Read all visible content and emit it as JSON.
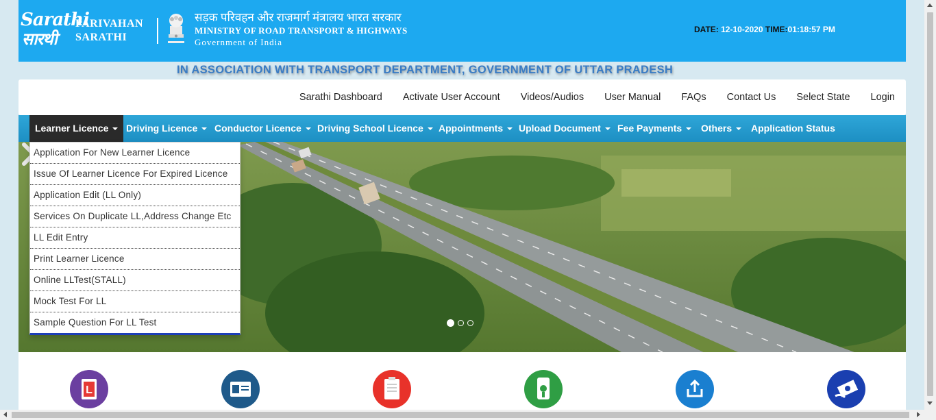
{
  "header": {
    "logo_line1": "Sarathi",
    "logo_line2": "सारथी",
    "brand_line1": "PARIVAHAN",
    "brand_line2": "SARATHI",
    "ministry_hindi": "सड़क परिवहन और राजमार्ग मंत्रालय भारत सरकार",
    "ministry_english": "MINISTRY OF ROAD TRANSPORT & HIGHWAYS",
    "government": "Government of India",
    "date_label": "DATE:",
    "date_value": "12-10-2020",
    "time_label": "TIME:",
    "time_value": "01:18:57 PM"
  },
  "association": "IN ASSOCIATION WITH TRANSPORT DEPARTMENT, GOVERNMENT OF UTTAR PRADESH",
  "topnav": [
    "Sarathi Dashboard",
    "Activate User Account",
    "Videos/Audios",
    "User Manual",
    "FAQs",
    "Contact Us",
    "Select State",
    "Login"
  ],
  "mainmenu": [
    "Learner Licence",
    "Driving Licence",
    "Conductor Licence",
    "Driving School Licence",
    "Appointments",
    "Upload Document",
    "Fee Payments",
    "Others",
    "Application Status"
  ],
  "dropdown": [
    "Application For New Learner Licence",
    "Issue Of Learner Licence For Expired Licence",
    "Application Edit (LL Only)",
    "Services On Duplicate LL,Address Change Etc",
    "LL Edit Entry",
    "Print Learner Licence",
    "Online LLTest(STALL)",
    "Mock Test For LL",
    "Sample Question For LL Test"
  ],
  "carousel": {
    "slides": 3,
    "active": 1
  },
  "service_icons": [
    {
      "icon": "learner-licence-icon",
      "color": "#6b3fa0"
    },
    {
      "icon": "id-card-icon",
      "color": "#1f5a8a"
    },
    {
      "icon": "clipboard-icon",
      "color": "#e8322a"
    },
    {
      "icon": "mobile-payment-icon",
      "color": "#2f9e44"
    },
    {
      "icon": "upload-icon",
      "color": "#1a7fd0"
    },
    {
      "icon": "fee-payment-icon",
      "color": "#1a3fb0"
    }
  ]
}
